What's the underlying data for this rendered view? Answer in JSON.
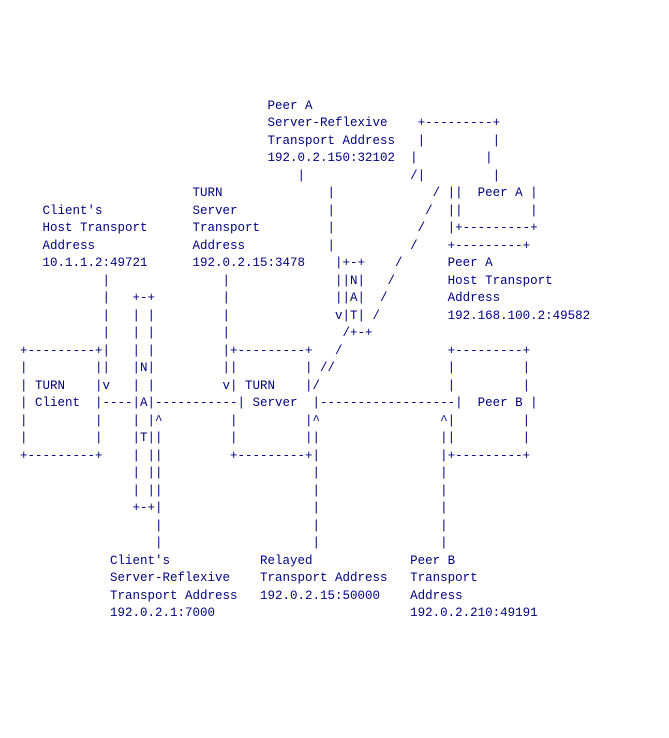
{
  "labels": {
    "peer_a_title": "Peer A",
    "peer_a_srflx1": "Server-Reflexive",
    "peer_a_srflx2": "Transport Address",
    "peer_a_srflx_addr": "192.0.2.150:32102",
    "peer_a_box": "Peer A",
    "turn_server1": "TURN",
    "turn_server2": "Server",
    "turn_server3": "Transport",
    "turn_server4": "Address",
    "turn_server_addr": "192.0.2.15:3478",
    "client1": "Client's",
    "client2": "Host Transport",
    "client3": "Address",
    "client_addr": "10.1.1.2:49721",
    "peer_a_host1": "Peer A",
    "peer_a_host2": "Host Transport",
    "peer_a_host3": "Address",
    "peer_a_host_addr": "192.168.100.2:49582",
    "turn_client1": "TURN",
    "turn_client2": "Client",
    "turn_server_box1": "TURN",
    "turn_server_box2": "Server",
    "peer_b_box": "Peer B",
    "client_srflx1": "Client's",
    "client_srflx2": "Server-Reflexive",
    "client_srflx3": "Transport Address",
    "client_srflx_addr": "192.0.2.1:7000",
    "relayed1": "Relayed",
    "relayed2": "Transport Address",
    "relayed_addr": "192.0.2.15:50000",
    "peer_b1": "Peer B",
    "peer_b2": "Transport",
    "peer_b3": "Address",
    "peer_b_addr": "192.0.2.210:49191"
  },
  "diagram_lines": [
    "                                 ${peer_a_title}",
    "                                 ${peer_a_srflx1}    +---------+",
    "                                 ${peer_a_srflx2}   |         |",
    "                                 ${peer_a_srflx_addr}  |         |",
    "                                     |              /|         |",
    "                       ${turn_server1}              |             / ||  ${peer_a_box} |",
    "   ${client1}            ${turn_server2}            |            /  ||         |",
    "   ${client2}      ${turn_server3}         |           /   |+---------+",
    "   ${client3}             ${turn_server4}           |          /    +---------+",
    "   ${client_addr}      ${turn_server_addr}    |+-+    /      ${peer_a_host1}",
    "           |               |              ||N|   /       ${peer_a_host2}",
    "           |   +-+         |              ||A|  /        ${peer_a_host3}",
    "           |   | |         |              v|T| /         ${peer_a_host_addr}",
    "           |   | |         |               /+-+",
    "+---------+|   | |         |+---------+   /              +---------+",
    "|         ||   |N|         ||         | //               |         |",
    "| ${turn_client1}    |v   | |         v| ${turn_server_box1}    |/                 |         |",
    "| ${turn_client2}  |----|A|-----------| ${turn_server_box2}  |------------------|  ${peer_b_box} |",
    "|         |    | |^         |         |^                ^|         |",
    "|         |    |T||         |         ||                ||         |",
    "+---------+    | ||         +---------+|                |+---------+",
    "               | ||                    |                |",
    "               | ||                    |                |",
    "               +-+|                    |                |",
    "                  |                    |                |",
    "                  |                    |                |",
    "            ${client_srflx1}            ${relayed1}             ${peer_b1}",
    "            ${client_srflx2}    ${relayed2}   ${peer_b2}",
    "            ${client_srflx3}   ${relayed_addr}    ${peer_b3}",
    "            ${client_srflx_addr}                          ${peer_b_addr}"
  ]
}
